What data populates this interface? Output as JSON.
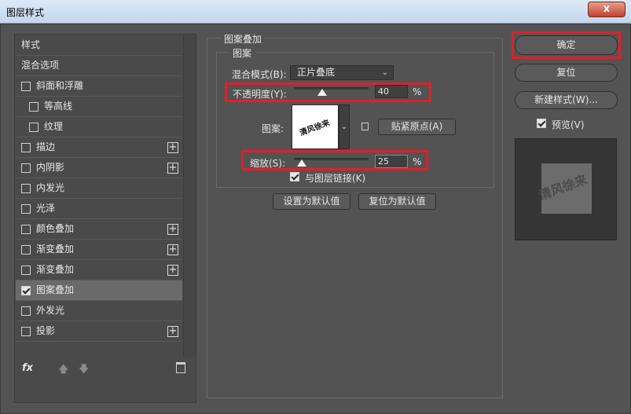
{
  "window": {
    "title": "图层样式",
    "close_label": "x"
  },
  "sidebar": {
    "items": [
      {
        "label": "样式"
      },
      {
        "label": "混合选项"
      },
      {
        "label": "斜面和浮雕"
      },
      {
        "label": "等高线"
      },
      {
        "label": "纹理"
      },
      {
        "label": "描边"
      },
      {
        "label": "内阴影"
      },
      {
        "label": "内发光"
      },
      {
        "label": "光泽"
      },
      {
        "label": "颜色叠加"
      },
      {
        "label": "渐变叠加"
      },
      {
        "label": "渐变叠加"
      },
      {
        "label": "图案叠加"
      },
      {
        "label": "外发光"
      },
      {
        "label": "投影"
      }
    ],
    "fx_label": "fx",
    "plus_label": "+"
  },
  "panel": {
    "title": "图案叠加",
    "subgroup_title": "图案",
    "blend_mode_label": "混合模式(B):",
    "blend_mode_value": "正片叠底",
    "opacity_label": "不透明度(Y):",
    "opacity_value": "40",
    "percent": "%",
    "pattern_label": "图案:",
    "pattern_text": "清风徐来",
    "snap_origin_label": "贴紧原点(A)",
    "scale_label": "缩放(S):",
    "scale_value": "25",
    "link_label": "与图层链接(K)",
    "set_default_label": "设置为默认值",
    "reset_default_label": "复位为默认值"
  },
  "right": {
    "ok_label": "确定",
    "reset_label": "复位",
    "new_style_label": "新建样式(W)...",
    "preview_label": "预览(V)",
    "preview_text": "清风徐来"
  },
  "colors": {
    "highlight": "#e0202a",
    "panel": "#535353"
  }
}
